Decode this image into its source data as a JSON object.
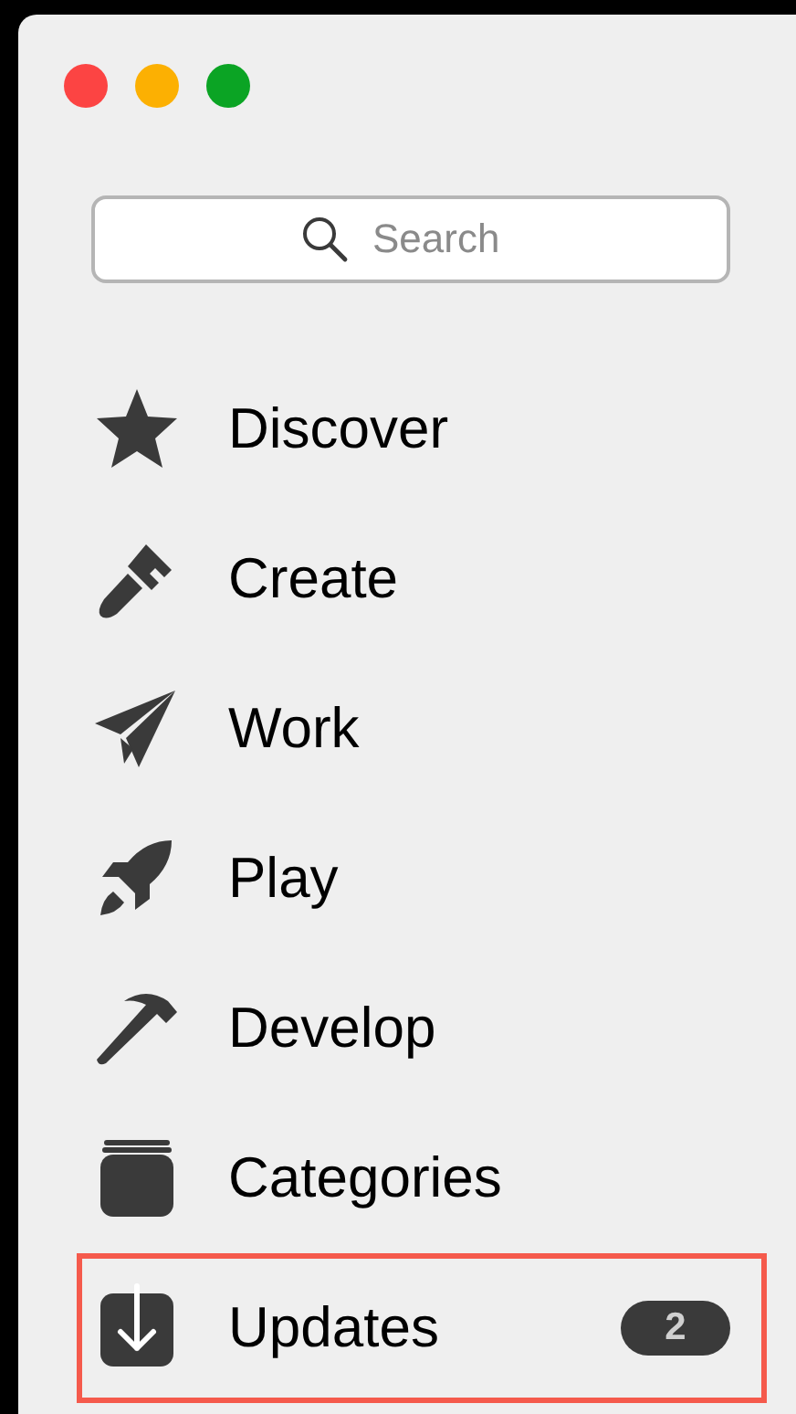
{
  "window": {
    "controls": [
      {
        "kind": "close"
      },
      {
        "kind": "minimize"
      },
      {
        "kind": "zoom"
      }
    ]
  },
  "search": {
    "placeholder": "Search"
  },
  "sidebar": {
    "items": [
      {
        "kind": "star",
        "label": "Discover",
        "highlighted": false
      },
      {
        "kind": "brush",
        "label": "Create",
        "highlighted": false
      },
      {
        "kind": "plane",
        "label": "Work",
        "highlighted": false
      },
      {
        "kind": "rocket",
        "label": "Play",
        "highlighted": false
      },
      {
        "kind": "hammer",
        "label": "Develop",
        "highlighted": false
      },
      {
        "kind": "stack",
        "label": "Categories",
        "highlighted": false
      },
      {
        "kind": "download",
        "label": "Updates",
        "highlighted": true,
        "badge": "2"
      }
    ]
  }
}
